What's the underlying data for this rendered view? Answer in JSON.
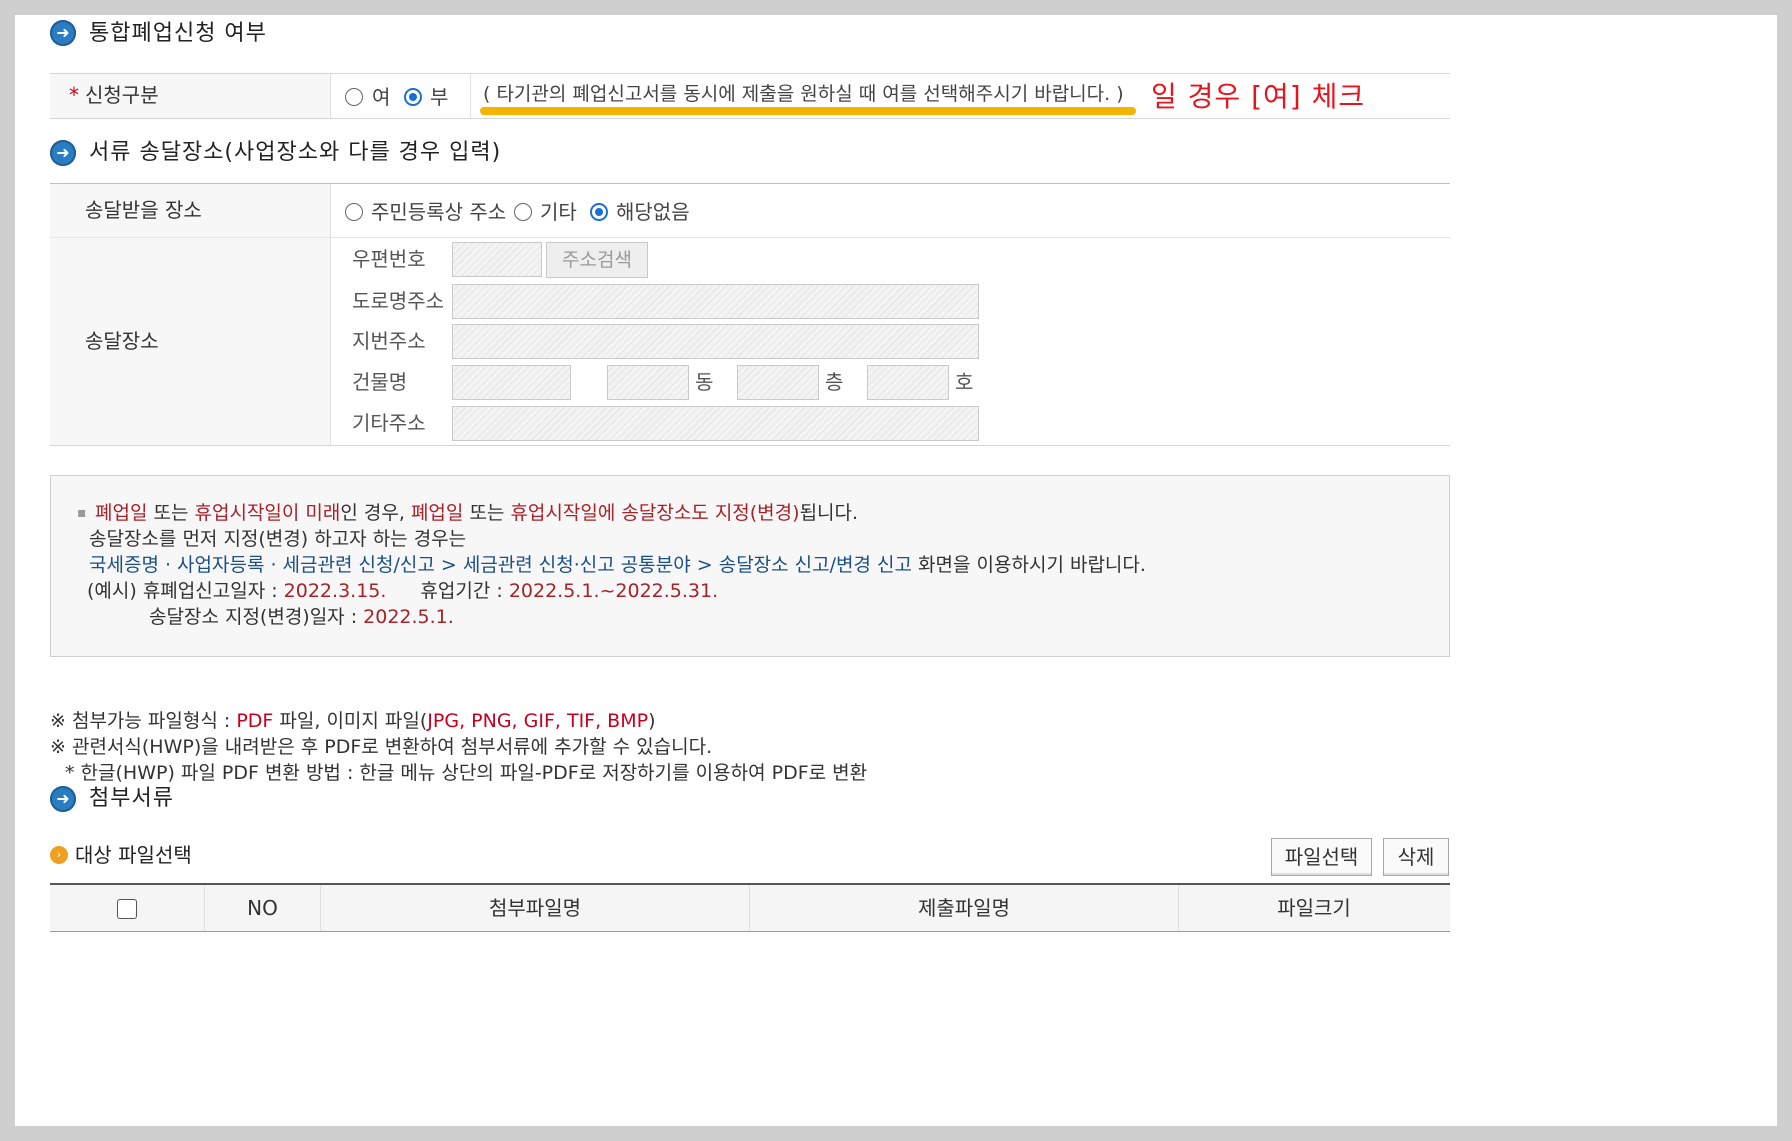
{
  "section_integrated": {
    "title": "통합폐업신청 여부",
    "label": "신청구분",
    "required_mark": "*",
    "options": [
      {
        "label": "여",
        "selected": false
      },
      {
        "label": "부",
        "selected": true
      }
    ],
    "hint": "( 타기관의 폐업신고서를 동시에 제출을 원하실 때 여를 선택해주시기 바랍니다. )",
    "annotation": "일 경우 [여] 체크",
    "annotation_color": "#e8141c",
    "highlight_color": "#f5b400"
  },
  "section_delivery": {
    "title": "서류 송달장소(사업장소와 다를 경우 입력)",
    "place_label": "송달받을 장소",
    "place_options": [
      {
        "label": "주민등록상 주소",
        "selected": false
      },
      {
        "label": "기타",
        "selected": false
      },
      {
        "label": "해당없음",
        "selected": true
      }
    ],
    "address_label": "송달장소",
    "zip_label": "우편번호",
    "search_button": "주소검색",
    "road_label": "도로명주소",
    "lot_label": "지번주소",
    "building_label": "건물명",
    "dong_suffix": "동",
    "floor_suffix": "층",
    "ho_suffix": "호",
    "other_label": "기타주소"
  },
  "notice": {
    "bullet": "▪",
    "line1": [
      {
        "t": "폐업일",
        "c": "dred"
      },
      {
        "t": " 또는 ",
        "c": ""
      },
      {
        "t": "휴업시작일이 미래",
        "c": "dred"
      },
      {
        "t": "인 경우, ",
        "c": ""
      },
      {
        "t": "폐업일",
        "c": "dred"
      },
      {
        "t": " 또는 ",
        "c": ""
      },
      {
        "t": "휴업시작일에 송달장소도 지정(변경)",
        "c": "dred"
      },
      {
        "t": "됩니다.",
        "c": ""
      }
    ],
    "line2": "송달장소를 먼저 지정(변경) 하고자 하는 경우는",
    "line3_link": "국세증명 · 사업자등록 · 세금관련 신청/신고 > 세금관련 신청·신고 공통분야 > 송달장소 신고/변경 신고",
    "line3_rest": " 화면을 이용하시기 바랍니다.",
    "line4_a": "(예시) 휴폐업신고일자 : ",
    "line4_b": "2022.3.15.",
    "line4_c": "휴업기간 : ",
    "line4_d": "2022.5.1.~2022.5.31.",
    "line5_a": "송달장소 지정(변경)일자 : ",
    "line5_b": "2022.5.1."
  },
  "file_notes": {
    "line1_a": "※ 첨부가능 파일형식 : ",
    "line1_b": "PDF",
    "line1_c": " 파일, 이미지 파일(",
    "line1_d": "JPG, PNG, GIF, TIF, BMP",
    "line1_e": ")",
    "line2": "※ 관련서식(HWP)을 내려받은 후 PDF로 변환하여 첨부서류에 추가할 수 있습니다.",
    "line3": "* 한글(HWP) 파일 PDF 변환 방법 : 한글 메뉴 상단의 파일-PDF로 저장하기를 이용하여 PDF로 변환"
  },
  "attachments": {
    "title": "첨부서류",
    "subtitle": "대상 파일선택",
    "select_button": "파일선택",
    "delete_button": "삭제",
    "columns": [
      "NO",
      "첨부파일명",
      "제출파일명",
      "파일크기"
    ]
  }
}
